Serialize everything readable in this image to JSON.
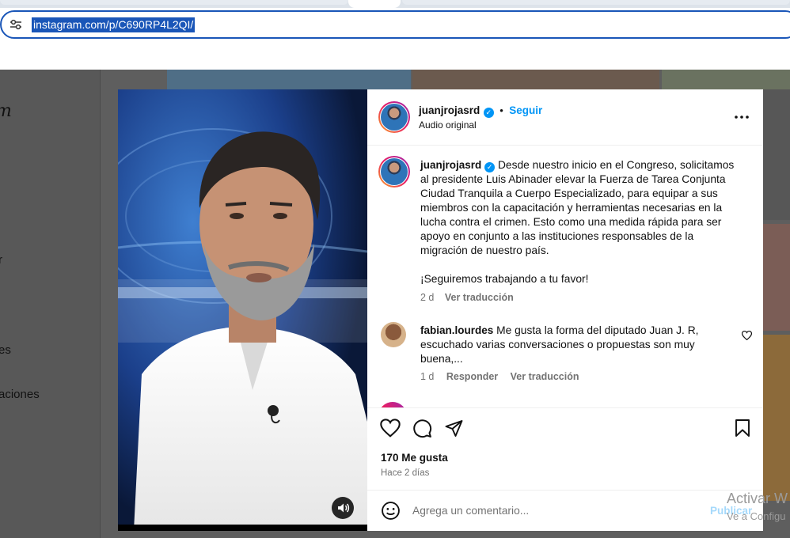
{
  "browser": {
    "url": "instagram.com/p/C690RP4L2QI/"
  },
  "sidebar": {
    "logo_fragment": "m",
    "item_r": "r",
    "item_es": "es",
    "item_aciones": "aciones"
  },
  "post": {
    "author": "juanjrojasrd",
    "follow_label": "Seguir",
    "separator": "•",
    "audio_label": "Audio original",
    "caption_main": "Desde nuestro inicio en el Congreso, solicitamos al presidente Luis Abinader elevar la Fuerza de Tarea Conjunta Ciudad Tranquila a Cuerpo Especializado, para equipar a sus miembros con la capacitación y herramientas necesarias en la lucha contra el crimen. Esto como una medida rápida para ser apoyo en conjunto a las instituciones responsables de la migración de nuestro país.",
    "caption_closing": "¡Seguiremos trabajando a tu favor!",
    "caption_age": "2 d",
    "translate_label": "Ver traducción",
    "likes": "170 Me gusta",
    "posted_ago": "Hace 2 días",
    "comment_placeholder": "Agrega un comentario...",
    "publish_label": "Publicar"
  },
  "comments": [
    {
      "user": "fabian.lourdes",
      "text": "Me gusta la forma del diputado Juan J. R, escuchado varias conversaciones o propuestas son muy buena,...",
      "age": "1 d",
      "reply_label": "Responder",
      "translate_label": "Ver traducción"
    }
  ],
  "watermark": {
    "line1": "Activar W",
    "line2": "Ve a Configu"
  },
  "colors": {
    "accent": "#0095f6",
    "url_highlight": "#1a56b8"
  },
  "icons": [
    "tune-icon",
    "verified-icon",
    "more-icon",
    "heart-icon",
    "comment-icon",
    "share-icon",
    "bookmark-icon",
    "emoji-icon",
    "volume-icon"
  ]
}
